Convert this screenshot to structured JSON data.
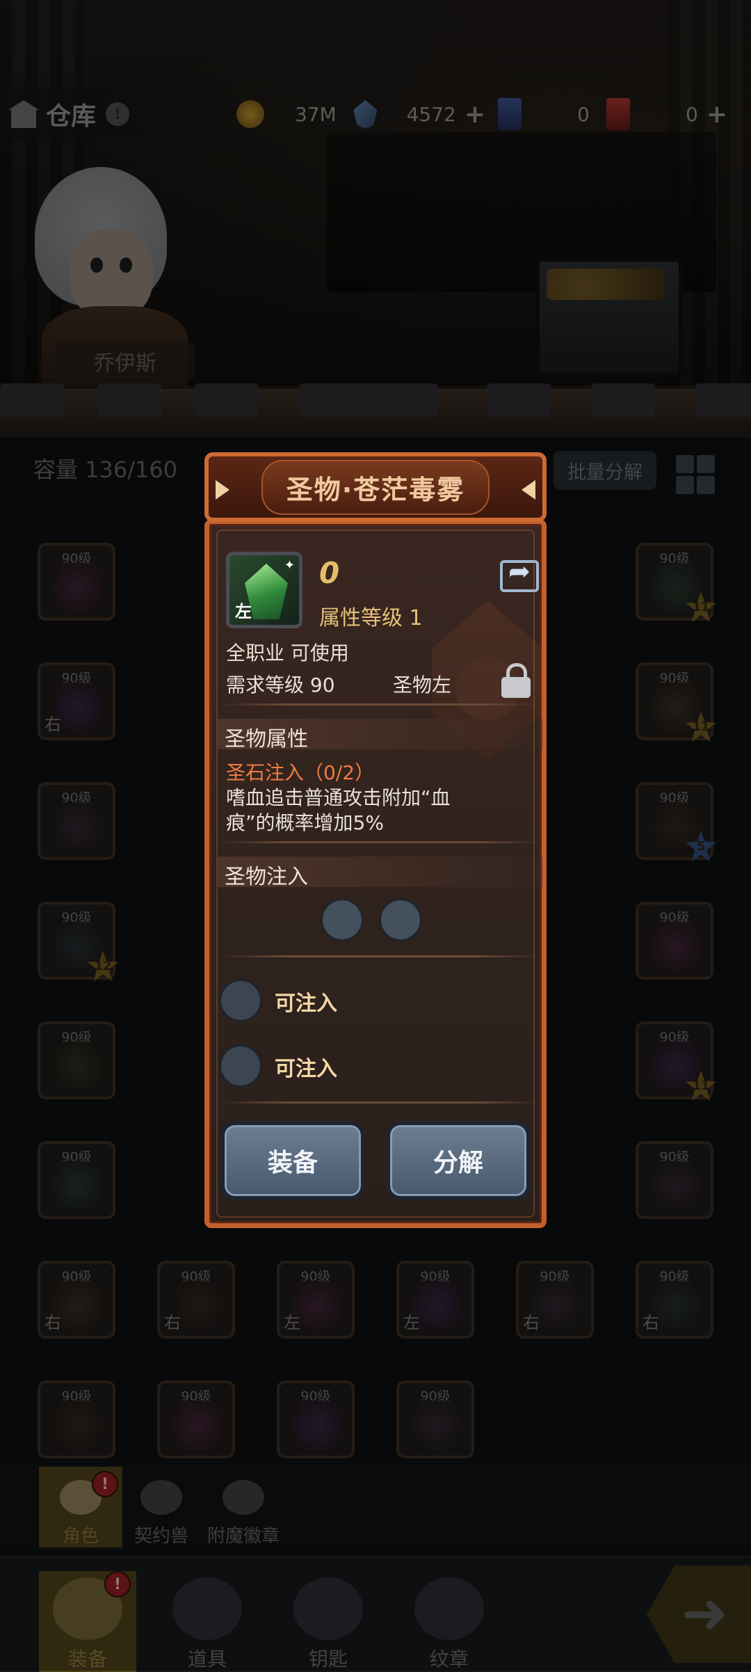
{
  "header": {
    "title": "仓库",
    "info_badge": "!",
    "resources": [
      {
        "name": "coins",
        "value": "37M"
      },
      {
        "name": "crystals",
        "value": "4572"
      },
      {
        "name": "blue-tickets",
        "value": "0"
      },
      {
        "name": "red-tickets",
        "value": "0"
      }
    ]
  },
  "hero": {
    "name": "乔伊斯"
  },
  "inventory": {
    "capacity_label": "容量 136/160",
    "batch_button": "批量分解",
    "level_label": "90级",
    "side_left": "左",
    "side_right": "右",
    "star_values": [
      "11",
      "11",
      "11",
      "5",
      "12",
      "11"
    ]
  },
  "popup": {
    "title": "圣物·苍茫毒雾",
    "item_side": "左",
    "enhance": "0",
    "attr_level": "属性等级 1",
    "class_req": "全职业 可使用",
    "level_req": "需求等级 90",
    "slot_type": "圣物左",
    "section_attr": "圣物属性",
    "stone_infuse": "圣石注入（0/2）",
    "effect_line1": "嗜血追击普通攻击附加“血",
    "effect_line2": "痕”的概率增加5%",
    "section_infuse": "圣物注入",
    "can_infuse_1": "可注入",
    "can_infuse_2": "可注入",
    "equip_button": "装备",
    "decompose_button": "分解"
  },
  "subtabs": [
    {
      "label": "角色",
      "badge": "!"
    },
    {
      "label": "契约兽"
    },
    {
      "label": "附魔徽章"
    }
  ],
  "nav": [
    {
      "label": "装备",
      "badge": "!"
    },
    {
      "label": "道具"
    },
    {
      "label": "钥匙"
    },
    {
      "label": "纹章"
    }
  ]
}
